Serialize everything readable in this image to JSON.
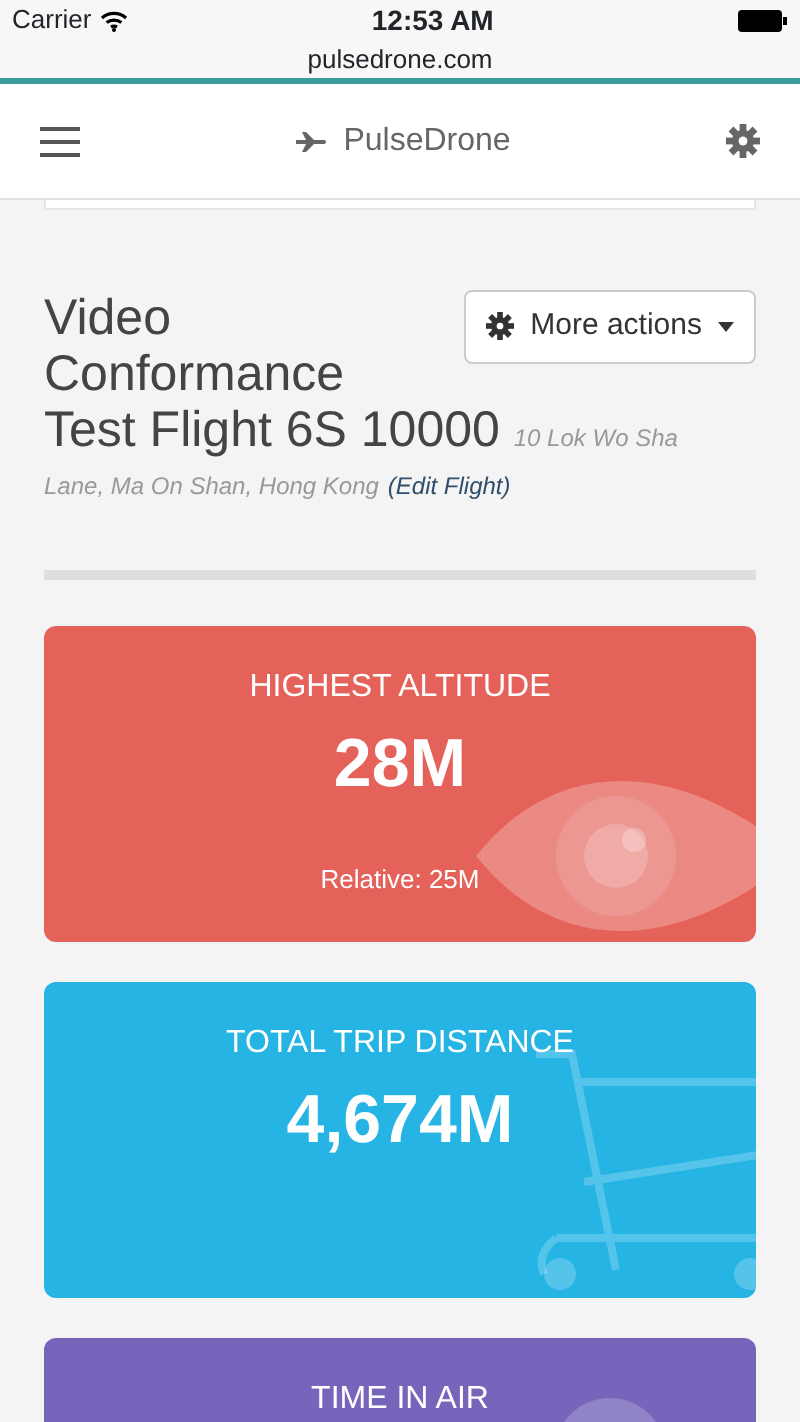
{
  "status_bar": {
    "carrier": "Carrier",
    "time": "12:53 AM"
  },
  "browser": {
    "url": "pulsedrone.com"
  },
  "navbar": {
    "brand": "PulseDrone"
  },
  "flight": {
    "title": "Video Conformance Test Flight 6S 10000",
    "address": [
      "10 Lok Wo Sha",
      "Lane, Ma On Shan, Hong Kong"
    ],
    "edit_link": "(Edit Flight)"
  },
  "actions_button": "More actions",
  "stats": [
    {
      "kind": "altitude",
      "color": "#e5625a",
      "label": "HIGHEST ALTITUDE",
      "value": "28M",
      "sub": "Relative: 25M"
    },
    {
      "kind": "distance",
      "color": "#26b4e4",
      "label": "TOTAL TRIP DISTANCE",
      "value": "4,674M"
    },
    {
      "kind": "time",
      "color": "#7665bb",
      "label": "TIME IN AIR"
    }
  ]
}
